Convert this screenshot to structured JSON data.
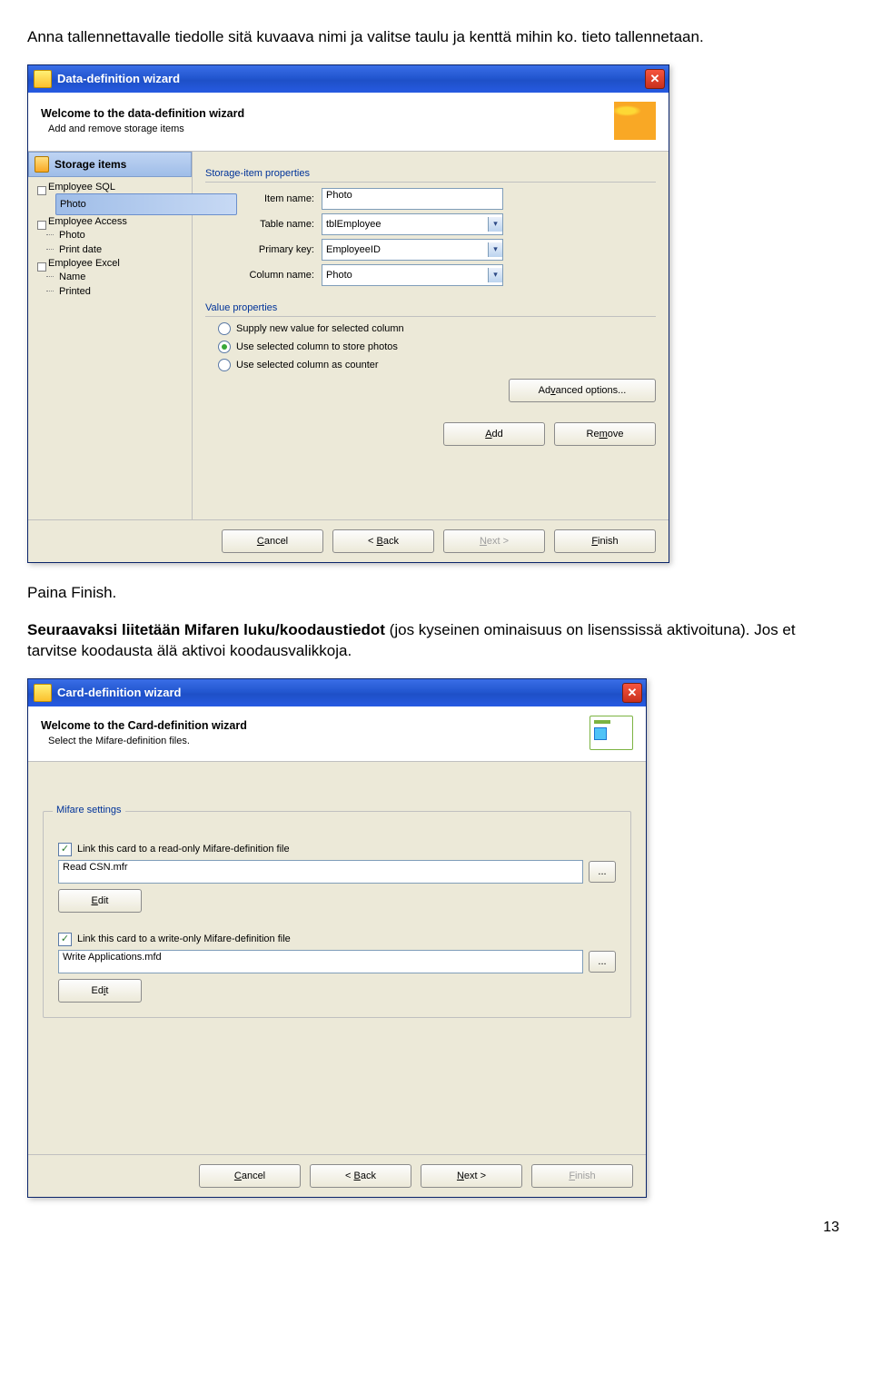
{
  "doc": {
    "para1": "Anna tallennettavalle tiedolle sitä kuvaava nimi ja valitse taulu ja kenttä mihin ko. tieto tallennetaan.",
    "para2": "Paina Finish.",
    "para3_bold": "Seuraavaksi liitetään Mifaren luku/koodaustiedot",
    "para3_rest": " (jos kyseinen ominaisuus on lisenssissä aktivoituna). Jos et tarvitse koodausta älä aktivoi koodausvalikkoja.",
    "page_number": "13"
  },
  "dataWizard": {
    "title": "Data-definition wizard",
    "banner_title": "Welcome to the data-definition wizard",
    "banner_desc": "Add and remove storage items",
    "storage_head": "Storage items",
    "tree": {
      "n0": "Employee SQL",
      "n0_0": "Photo",
      "n1": "Employee Access",
      "n1_0": "Photo",
      "n1_1": "Print date",
      "n2": "Employee Excel",
      "n2_0": "Name",
      "n2_1": "Printed"
    },
    "sec_props": "Storage-item properties",
    "lbl_item": "Item name:",
    "val_item": "Photo",
    "lbl_table": "Table name:",
    "val_table": "tblEmployee",
    "lbl_pk": "Primary key:",
    "val_pk": "EmployeeID",
    "lbl_col": "Column name:",
    "val_col": "Photo",
    "sec_value": "Value properties",
    "radio_supply": "Supply new value for selected column",
    "radio_store": "Use selected column to store photos",
    "radio_counter": "Use selected column as counter",
    "btn_adv": "Advanced options...",
    "btn_add": "Add",
    "btn_remove": "Remove",
    "btn_cancel": "Cancel",
    "btn_back": "< Back",
    "btn_next": "Next >",
    "btn_finish": "Finish"
  },
  "cardWizard": {
    "title": "Card-definition wizard",
    "banner_title": "Welcome to the Card-definition wizard",
    "banner_desc": "Select the Mifare-definition files.",
    "legend": "Mifare settings",
    "chk_read": "Link this card to a read-only Mifare-definition file",
    "file_read": "Read CSN.mfr",
    "btn_edit": "Edit",
    "chk_write": "Link this card to a write-only Mifare-definition file",
    "file_write": "Write Applications.mfd",
    "btn_cancel": "Cancel",
    "btn_back": "< Back",
    "btn_next": "Next >",
    "btn_finish": "Finish"
  }
}
